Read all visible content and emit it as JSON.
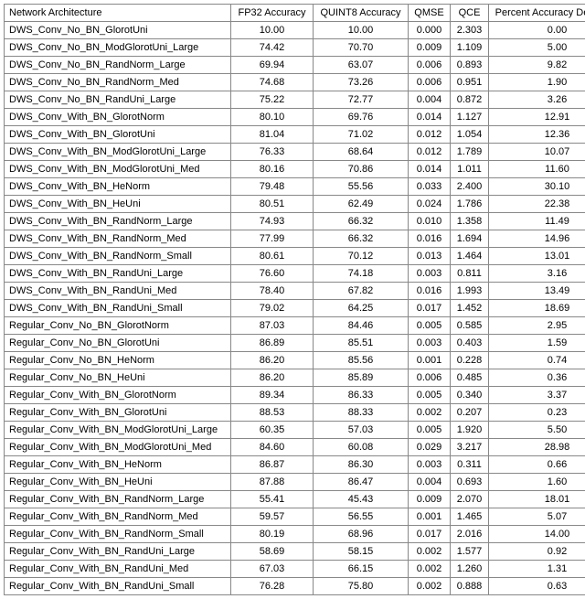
{
  "headers": {
    "arch": "Network Architecture",
    "fp32": "FP32 Accuracy",
    "quint8": "QUINT8 Accuracy",
    "qmse": "QMSE",
    "qce": "QCE",
    "pad": "Percent Accuracy Decrease"
  },
  "rows": [
    {
      "arch": "DWS_Conv_No_BN_GlorotUni",
      "fp32": "10.00",
      "quint8": "10.00",
      "qmse": "0.000",
      "qce": "2.303",
      "pad": "0.00"
    },
    {
      "arch": "DWS_Conv_No_BN_ModGlorotUni_Large",
      "fp32": "74.42",
      "quint8": "70.70",
      "qmse": "0.009",
      "qce": "1.109",
      "pad": "5.00"
    },
    {
      "arch": "DWS_Conv_No_BN_RandNorm_Large",
      "fp32": "69.94",
      "quint8": "63.07",
      "qmse": "0.006",
      "qce": "0.893",
      "pad": "9.82"
    },
    {
      "arch": "DWS_Conv_No_BN_RandNorm_Med",
      "fp32": "74.68",
      "quint8": "73.26",
      "qmse": "0.006",
      "qce": "0.951",
      "pad": "1.90"
    },
    {
      "arch": "DWS_Conv_No_BN_RandUni_Large",
      "fp32": "75.22",
      "quint8": "72.77",
      "qmse": "0.004",
      "qce": "0.872",
      "pad": "3.26"
    },
    {
      "arch": "DWS_Conv_With_BN_GlorotNorm",
      "fp32": "80.10",
      "quint8": "69.76",
      "qmse": "0.014",
      "qce": "1.127",
      "pad": "12.91"
    },
    {
      "arch": "DWS_Conv_With_BN_GlorotUni",
      "fp32": "81.04",
      "quint8": "71.02",
      "qmse": "0.012",
      "qce": "1.054",
      "pad": "12.36"
    },
    {
      "arch": "DWS_Conv_With_BN_ModGlorotUni_Large",
      "fp32": "76.33",
      "quint8": "68.64",
      "qmse": "0.012",
      "qce": "1.789",
      "pad": "10.07"
    },
    {
      "arch": "DWS_Conv_With_BN_ModGlorotUni_Med",
      "fp32": "80.16",
      "quint8": "70.86",
      "qmse": "0.014",
      "qce": "1.011",
      "pad": "11.60"
    },
    {
      "arch": "DWS_Conv_With_BN_HeNorm",
      "fp32": "79.48",
      "quint8": "55.56",
      "qmse": "0.033",
      "qce": "2.400",
      "pad": "30.10"
    },
    {
      "arch": "DWS_Conv_With_BN_HeUni",
      "fp32": "80.51",
      "quint8": "62.49",
      "qmse": "0.024",
      "qce": "1.786",
      "pad": "22.38"
    },
    {
      "arch": "DWS_Conv_With_BN_RandNorm_Large",
      "fp32": "74.93",
      "quint8": "66.32",
      "qmse": "0.010",
      "qce": "1.358",
      "pad": "11.49"
    },
    {
      "arch": "DWS_Conv_With_BN_RandNorm_Med",
      "fp32": "77.99",
      "quint8": "66.32",
      "qmse": "0.016",
      "qce": "1.694",
      "pad": "14.96"
    },
    {
      "arch": "DWS_Conv_With_BN_RandNorm_Small",
      "fp32": "80.61",
      "quint8": "70.12",
      "qmse": "0.013",
      "qce": "1.464",
      "pad": "13.01"
    },
    {
      "arch": "DWS_Conv_With_BN_RandUni_Large",
      "fp32": "76.60",
      "quint8": "74.18",
      "qmse": "0.003",
      "qce": "0.811",
      "pad": "3.16"
    },
    {
      "arch": "DWS_Conv_With_BN_RandUni_Med",
      "fp32": "78.40",
      "quint8": "67.82",
      "qmse": "0.016",
      "qce": "1.993",
      "pad": "13.49"
    },
    {
      "arch": "DWS_Conv_With_BN_RandUni_Small",
      "fp32": "79.02",
      "quint8": "64.25",
      "qmse": "0.017",
      "qce": "1.452",
      "pad": "18.69"
    },
    {
      "arch": "Regular_Conv_No_BN_GlorotNorm",
      "fp32": "87.03",
      "quint8": "84.46",
      "qmse": "0.005",
      "qce": "0.585",
      "pad": "2.95"
    },
    {
      "arch": "Regular_Conv_No_BN_GlorotUni",
      "fp32": "86.89",
      "quint8": "85.51",
      "qmse": "0.003",
      "qce": "0.403",
      "pad": "1.59"
    },
    {
      "arch": "Regular_Conv_No_BN_HeNorm",
      "fp32": "86.20",
      "quint8": "85.56",
      "qmse": "0.001",
      "qce": "0.228",
      "pad": "0.74"
    },
    {
      "arch": "Regular_Conv_No_BN_HeUni",
      "fp32": "86.20",
      "quint8": "85.89",
      "qmse": "0.006",
      "qce": "0.485",
      "pad": "0.36"
    },
    {
      "arch": "Regular_Conv_With_BN_GlorotNorm",
      "fp32": "89.34",
      "quint8": "86.33",
      "qmse": "0.005",
      "qce": "0.340",
      "pad": "3.37"
    },
    {
      "arch": "Regular_Conv_With_BN_GlorotUni",
      "fp32": "88.53",
      "quint8": "88.33",
      "qmse": "0.002",
      "qce": "0.207",
      "pad": "0.23"
    },
    {
      "arch": "Regular_Conv_With_BN_ModGlorotUni_Large",
      "fp32": "60.35",
      "quint8": "57.03",
      "qmse": "0.005",
      "qce": "1.920",
      "pad": "5.50"
    },
    {
      "arch": "Regular_Conv_With_BN_ModGlorotUni_Med",
      "fp32": "84.60",
      "quint8": "60.08",
      "qmse": "0.029",
      "qce": "3.217",
      "pad": "28.98"
    },
    {
      "arch": "Regular_Conv_With_BN_HeNorm",
      "fp32": "86.87",
      "quint8": "86.30",
      "qmse": "0.003",
      "qce": "0.311",
      "pad": "0.66"
    },
    {
      "arch": "Regular_Conv_With_BN_HeUni",
      "fp32": "87.88",
      "quint8": "86.47",
      "qmse": "0.004",
      "qce": "0.693",
      "pad": "1.60"
    },
    {
      "arch": "Regular_Conv_With_BN_RandNorm_Large",
      "fp32": "55.41",
      "quint8": "45.43",
      "qmse": "0.009",
      "qce": "2.070",
      "pad": "18.01"
    },
    {
      "arch": "Regular_Conv_With_BN_RandNorm_Med",
      "fp32": "59.57",
      "quint8": "56.55",
      "qmse": "0.001",
      "qce": "1.465",
      "pad": "5.07"
    },
    {
      "arch": "Regular_Conv_With_BN_RandNorm_Small",
      "fp32": "80.19",
      "quint8": "68.96",
      "qmse": "0.017",
      "qce": "2.016",
      "pad": "14.00"
    },
    {
      "arch": "Regular_Conv_With_BN_RandUni_Large",
      "fp32": "58.69",
      "quint8": "58.15",
      "qmse": "0.002",
      "qce": "1.577",
      "pad": "0.92"
    },
    {
      "arch": "Regular_Conv_With_BN_RandUni_Med",
      "fp32": "67.03",
      "quint8": "66.15",
      "qmse": "0.002",
      "qce": "1.260",
      "pad": "1.31"
    },
    {
      "arch": "Regular_Conv_With_BN_RandUni_Small",
      "fp32": "76.28",
      "quint8": "75.80",
      "qmse": "0.002",
      "qce": "0.888",
      "pad": "0.63"
    }
  ]
}
